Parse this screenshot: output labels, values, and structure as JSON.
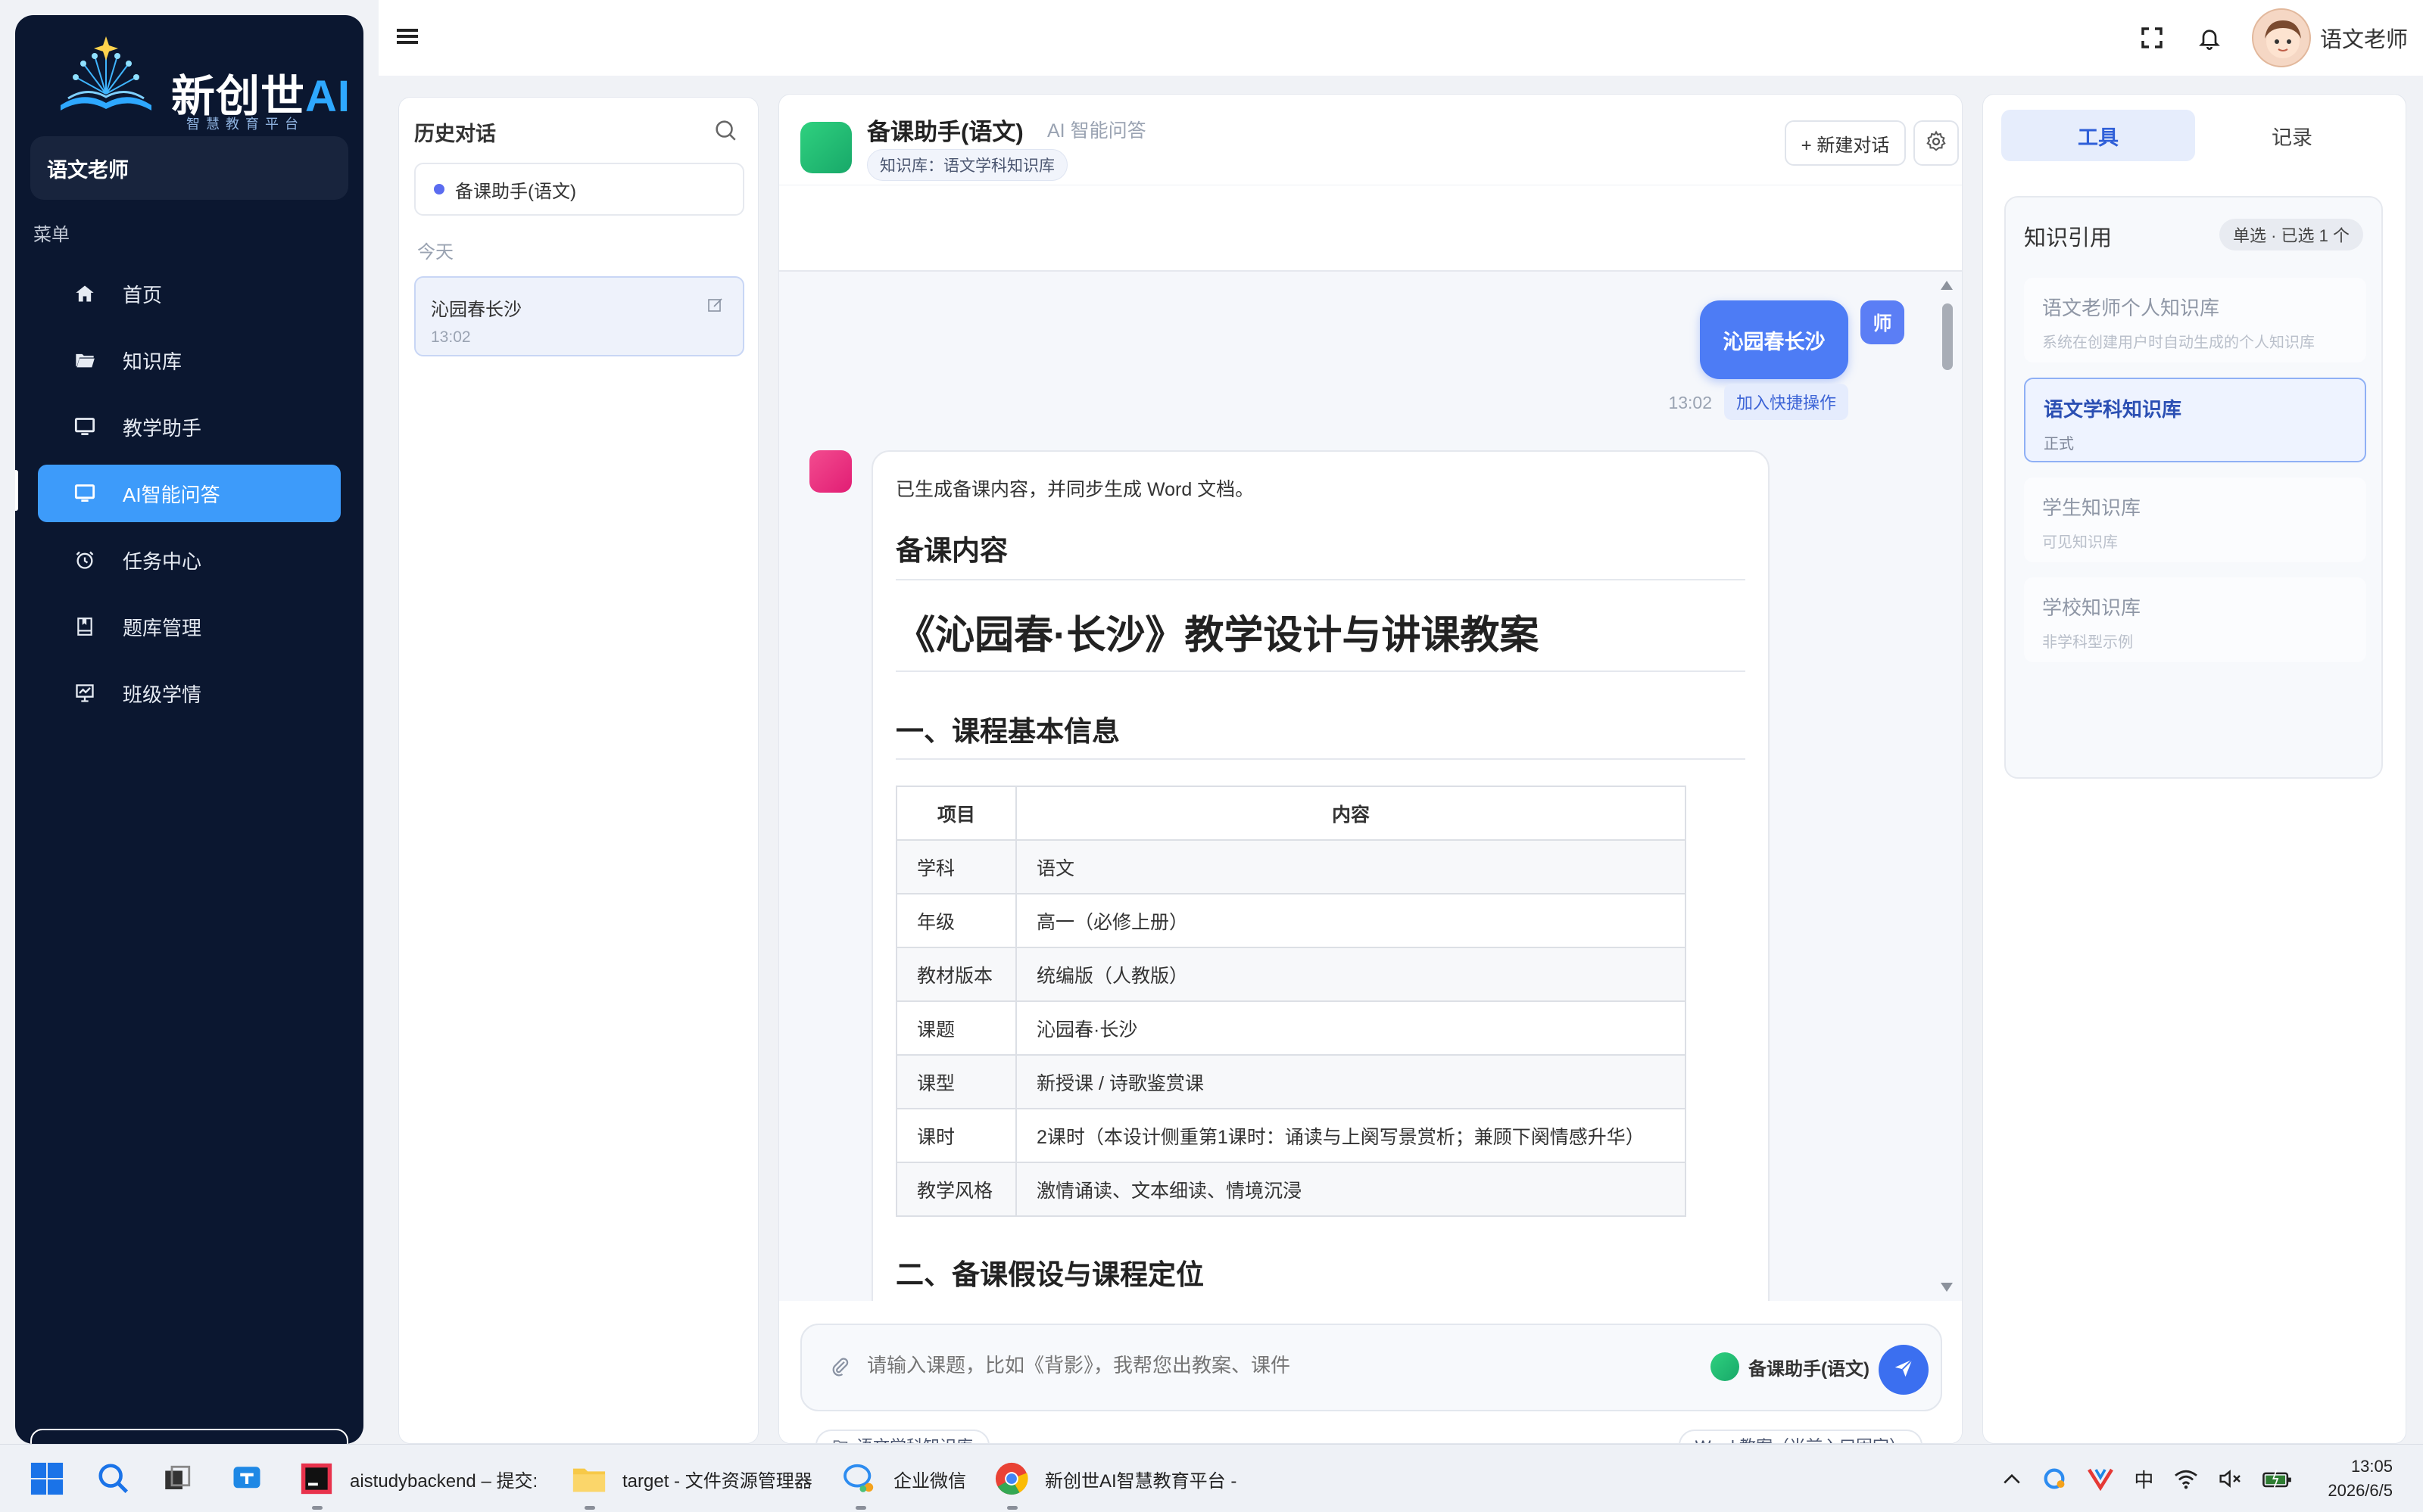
{
  "app": {
    "brand_title": "新创世",
    "brand_ai": "AI",
    "brand_subtitle": "智慧教育平台",
    "user_role": "语文老师",
    "menu_title": "菜单"
  },
  "nav": [
    {
      "label": "首页",
      "icon": "home-icon"
    },
    {
      "label": "知识库",
      "icon": "folder-icon"
    },
    {
      "label": "教学助手",
      "icon": "monitor-icon"
    },
    {
      "label": "AI智能问答",
      "icon": "monitor-icon",
      "active": true
    },
    {
      "label": "任务中心",
      "icon": "alarm-clock-icon"
    },
    {
      "label": "题库管理",
      "icon": "book-icon"
    },
    {
      "label": "班级学情",
      "icon": "chart-board-icon"
    }
  ],
  "topbar": {
    "username": "语文老师"
  },
  "history": {
    "title": "历史对话",
    "current_agent": "备课助手(语文)",
    "section_today": "今天",
    "items": [
      {
        "title": "沁园春长沙",
        "time": "13:02"
      }
    ]
  },
  "chat": {
    "agent_name": "备课助手(语文)",
    "mode": "AI 智能问答",
    "kb_tag": "知识库：语文学科知识库",
    "new_chat_label": "+ 新建对话",
    "user_message": "沁园春长沙",
    "teacher_badge": "师",
    "message_time": "13:02",
    "quick_action_label": "加入快捷操作",
    "answer": {
      "intro": "已生成备课内容，并同步生成 Word 文档。",
      "heading_prep": "备课内容",
      "doc_title": "《沁园春·长沙》教学设计与讲课教案",
      "section1": "一、课程基本信息",
      "table_headers": [
        "项目",
        "内容"
      ],
      "table_rows": [
        [
          "学科",
          "语文"
        ],
        [
          "年级",
          "高一（必修上册）"
        ],
        [
          "教材版本",
          "统编版（人教版）"
        ],
        [
          "课题",
          "沁园春·长沙"
        ],
        [
          "课型",
          "新授课 / 诗歌鉴赏课"
        ],
        [
          "课时",
          "2课时（本设计侧重第1课时：诵读与上阕写景赏析；兼顾下阕情感升华）"
        ],
        [
          "教学风格",
          "激情诵读、文本细读、情境沉浸"
        ]
      ],
      "section2": "二、备课假设与课程定位"
    },
    "input_placeholder": "请输入课题，比如《背影》，我帮您出教案、课件",
    "input_agent": "备课助手(语文)",
    "chip_kb": "语文学科知识库",
    "chip_word": "Word 教案（当前入口固定）"
  },
  "tools": {
    "tabs": [
      {
        "label": "工具",
        "active": true
      },
      {
        "label": "记录",
        "active": false
      }
    ],
    "kb_title": "知识引用",
    "kb_badge": "单选 · 已选 1 个",
    "kb_items": [
      {
        "name": "语文老师个人知识库",
        "desc": "系统在创建用户时自动生成的个人知识库",
        "selected": false
      },
      {
        "name": "语文学科知识库",
        "desc": "正式",
        "selected": true
      },
      {
        "name": "学生知识库",
        "desc": "可见知识库",
        "selected": false
      },
      {
        "name": "学校知识库",
        "desc": "非学科型示例",
        "selected": false
      }
    ]
  },
  "taskbar": {
    "apps": [
      {
        "label": "aistudybackend – 提交:"
      },
      {
        "label": "target - 文件资源管理器"
      },
      {
        "label": "企业微信"
      },
      {
        "label": "新创世AI智慧教育平台 -"
      }
    ],
    "ime": "中",
    "time": "13:05",
    "date": "2026/6/5"
  },
  "colors": {
    "sidebar_bg": "#0b1730",
    "accent": "#3d9bfa",
    "primary": "#3b6ff0"
  }
}
